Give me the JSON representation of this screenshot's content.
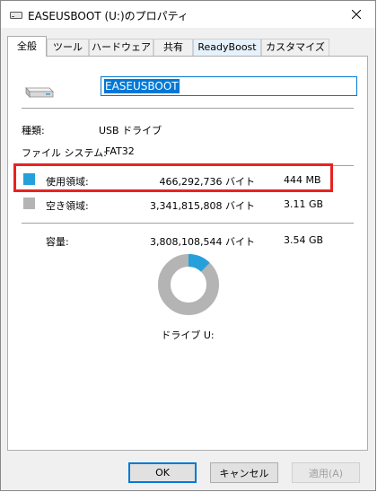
{
  "window": {
    "title": "EASEUSBOOT (U:)のプロパティ",
    "close_icon": "close-icon"
  },
  "tabs": [
    "全般",
    "ツール",
    "ハードウェア",
    "共有",
    "ReadyBoost",
    "カスタマイズ"
  ],
  "active_tab": "全般",
  "volume_name": "EASEUSBOOT",
  "type": {
    "label": "種類:",
    "value": "USB ドライブ"
  },
  "filesystem": {
    "label": "ファイル システム:",
    "value": "FAT32"
  },
  "used": {
    "label": "使用領域:",
    "bytes": "466,292,736 バイト",
    "size": "444 MB",
    "color": "#26a0da"
  },
  "free": {
    "label": "空き領域:",
    "bytes": "3,341,815,808 バイト",
    "size": "3.11 GB",
    "color": "#b4b4b4"
  },
  "capacity": {
    "label": "容量:",
    "bytes": "3,808,108,544 バイト",
    "size": "3.54 GB"
  },
  "used_fraction": 0.1224,
  "highlight_color": "#e8231f",
  "drive_label": "ドライブ U:",
  "buttons": {
    "ok": "OK",
    "cancel": "キャンセル",
    "apply": "適用(A)"
  }
}
